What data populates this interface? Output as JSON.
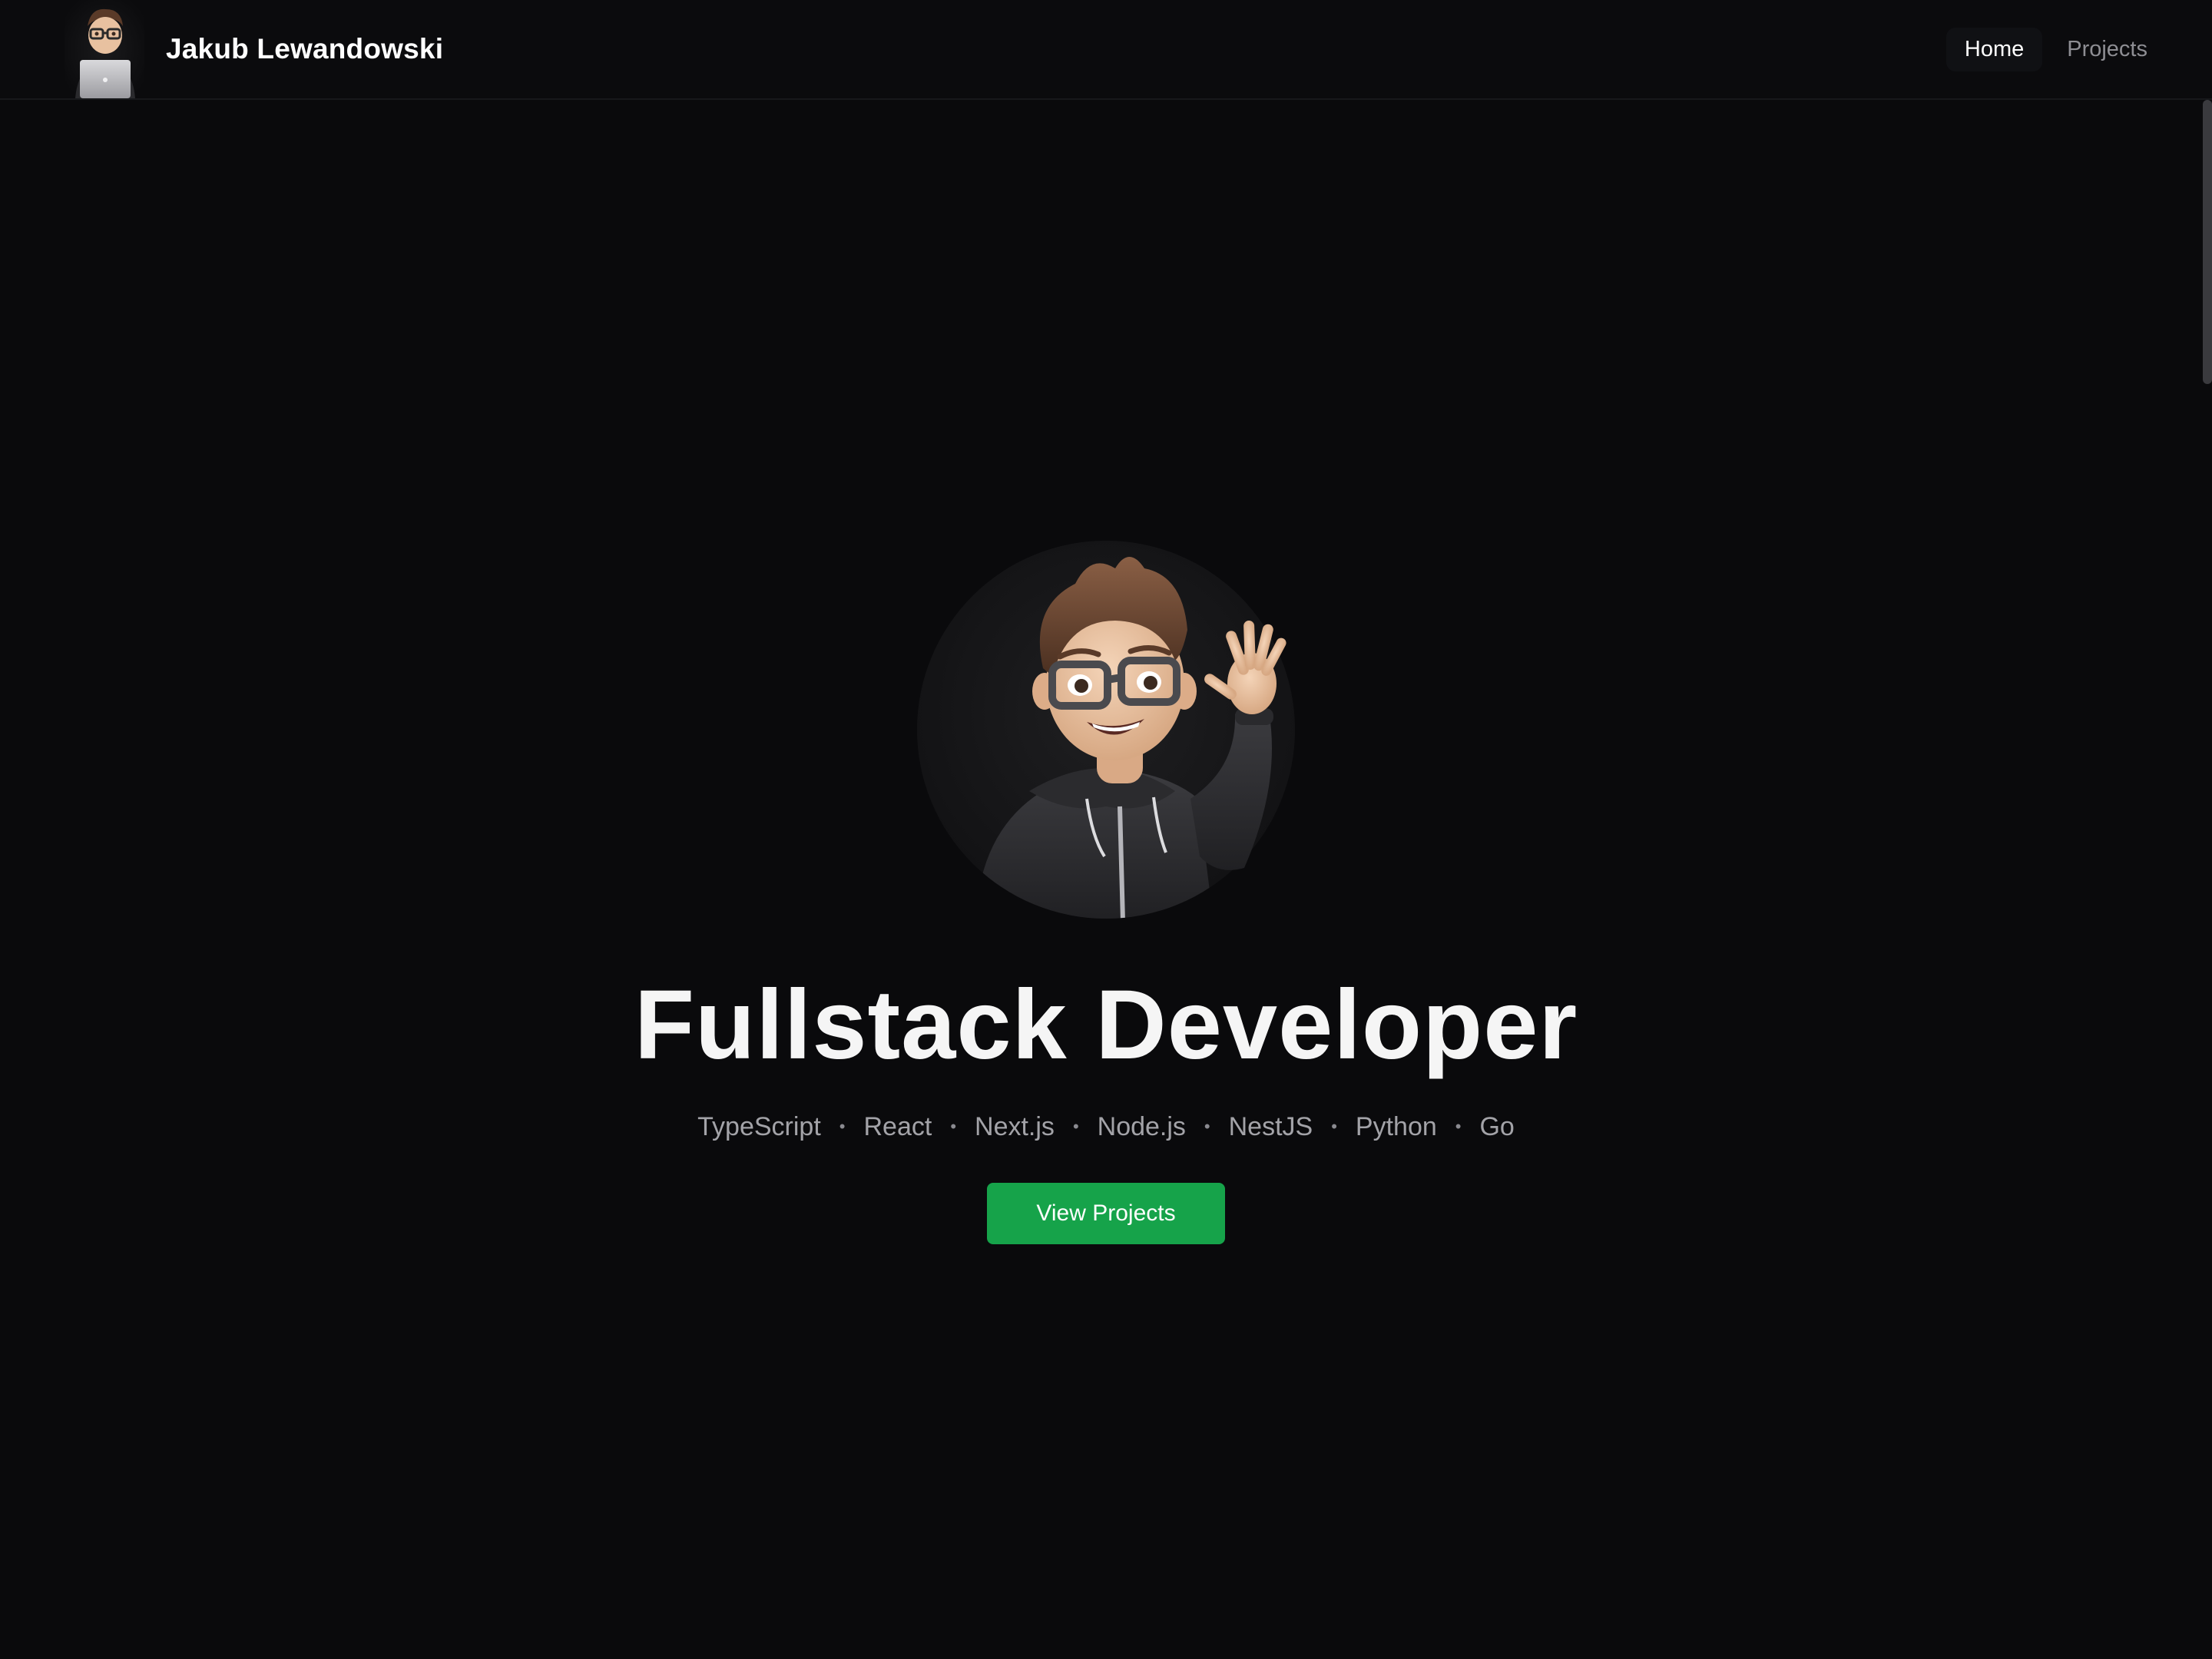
{
  "header": {
    "brand_name": "Jakub Lewandowski",
    "avatar_icon": "memoji-laptop-avatar",
    "nav": [
      {
        "label": "Home",
        "active": true
      },
      {
        "label": "Projects",
        "active": false
      }
    ]
  },
  "hero": {
    "avatar_icon": "memoji-waving-avatar",
    "title": "Fullstack Developer",
    "tech": [
      "TypeScript",
      "React",
      "Next.js",
      "Node.js",
      "NestJS",
      "Python",
      "Go"
    ],
    "separator": "•",
    "cta_label": "View Projects"
  },
  "colors": {
    "background": "#0a0a0c",
    "accent": "#16a34a",
    "text_primary": "#ffffff",
    "text_muted": "#a3a3a8"
  }
}
